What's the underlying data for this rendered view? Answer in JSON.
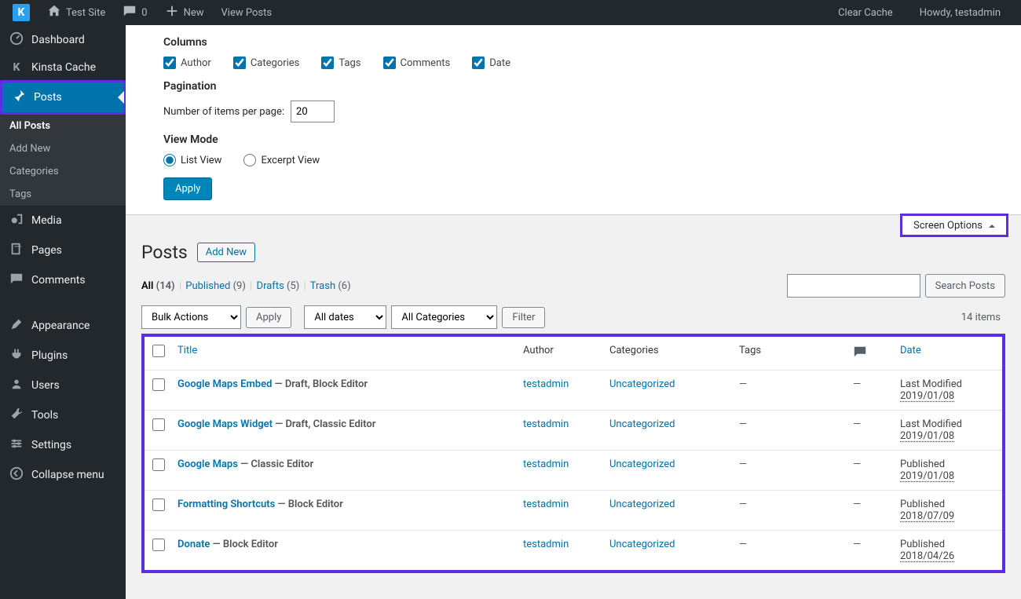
{
  "adminbar": {
    "site_name": "Test Site",
    "comments_count": "0",
    "new_label": "New",
    "view_posts_label": "View Posts",
    "clear_cache": "Clear Cache",
    "howdy": "Howdy, testadmin"
  },
  "sidebar": {
    "dashboard": "Dashboard",
    "kinsta_cache": "Kinsta Cache",
    "posts": "Posts",
    "sub_all_posts": "All Posts",
    "sub_add_new": "Add New",
    "sub_categories": "Categories",
    "sub_tags": "Tags",
    "media": "Media",
    "pages": "Pages",
    "comments": "Comments",
    "appearance": "Appearance",
    "plugins": "Plugins",
    "users": "Users",
    "tools": "Tools",
    "settings": "Settings",
    "collapse": "Collapse menu"
  },
  "screen_options": {
    "columns_heading": "Columns",
    "col_author": "Author",
    "col_categories": "Categories",
    "col_tags": "Tags",
    "col_comments": "Comments",
    "col_date": "Date",
    "pagination_heading": "Pagination",
    "per_page_label": "Number of items per page:",
    "per_page_value": "20",
    "view_mode_heading": "View Mode",
    "list_view": "List View",
    "excerpt_view": "Excerpt View",
    "apply_btn": "Apply",
    "tab_label": "Screen Options"
  },
  "header": {
    "title": "Posts",
    "add_new": "Add New"
  },
  "status_filters": {
    "all_label": "All",
    "all_count": "(14)",
    "published_label": "Published",
    "published_count": "(9)",
    "drafts_label": "Drafts",
    "drafts_count": "(5)",
    "trash_label": "Trash",
    "trash_count": "(6)"
  },
  "search": {
    "button": "Search Posts"
  },
  "bulk": {
    "actions_label": "Bulk Actions",
    "apply": "Apply",
    "all_dates": "All dates",
    "all_categories": "All Categories",
    "filter": "Filter",
    "item_count": "14 items"
  },
  "table": {
    "th_title": "Title",
    "th_author": "Author",
    "th_categories": "Categories",
    "th_tags": "Tags",
    "th_date": "Date",
    "rows": [
      {
        "title": "Google Maps Embed",
        "state": " — Draft, Block Editor",
        "author": "testadmin",
        "category": "Uncategorized",
        "tags": "—",
        "comments": "—",
        "status": "Last Modified",
        "date": "2019/01/08"
      },
      {
        "title": "Google Maps Widget",
        "state": " — Draft, Classic Editor",
        "author": "testadmin",
        "category": "Uncategorized",
        "tags": "—",
        "comments": "—",
        "status": "Last Modified",
        "date": "2019/01/08"
      },
      {
        "title": "Google Maps",
        "state": " — Classic Editor",
        "author": "testadmin",
        "category": "Uncategorized",
        "tags": "—",
        "comments": "—",
        "status": "Published",
        "date": "2019/01/08"
      },
      {
        "title": "Formatting Shortcuts",
        "state": " — Block Editor",
        "author": "testadmin",
        "category": "Uncategorized",
        "tags": "—",
        "comments": "—",
        "status": "Published",
        "date": "2018/07/09"
      },
      {
        "title": "Donate",
        "state": " — Block Editor",
        "author": "testadmin",
        "category": "Uncategorized",
        "tags": "—",
        "comments": "—",
        "status": "Published",
        "date": "2018/04/26"
      }
    ]
  }
}
